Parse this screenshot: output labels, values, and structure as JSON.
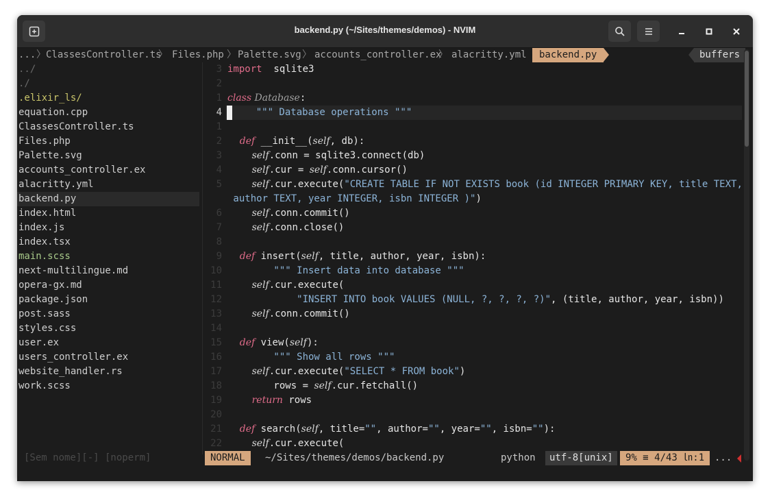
{
  "window": {
    "title": "backend.py (~/Sites/themes/demos) - NVIM"
  },
  "titlebar_icons": {
    "new_tab": "new-tab-icon",
    "search": "search-icon",
    "menu": "hamburger-menu-icon",
    "minimize": "minimize-icon",
    "maximize": "maximize-icon",
    "close": "close-icon"
  },
  "tabline": {
    "ellipsis": "...",
    "tabs": [
      "ClassesController.ts",
      "Files.php",
      "Palette.svg",
      "accounts_controller.ex",
      "alacritty.yml"
    ],
    "active": "backend.py",
    "buffers": "buffers"
  },
  "sidebar": {
    "items": [
      {
        "label": "../",
        "kind": "dir"
      },
      {
        "label": "./",
        "kind": "dir"
      },
      {
        "label": ".elixir_ls/",
        "kind": "lsp"
      },
      {
        "label": "equation.cpp",
        "kind": "file"
      },
      {
        "label": "ClassesController.ts",
        "kind": "file"
      },
      {
        "label": "Files.php",
        "kind": "file"
      },
      {
        "label": "Palette.svg",
        "kind": "file"
      },
      {
        "label": "accounts_controller.ex",
        "kind": "file"
      },
      {
        "label": "alacritty.yml",
        "kind": "file"
      },
      {
        "label": "backend.py",
        "kind": "file",
        "selected": true
      },
      {
        "label": "index.html",
        "kind": "file"
      },
      {
        "label": "index.js",
        "kind": "file"
      },
      {
        "label": "index.tsx",
        "kind": "file"
      },
      {
        "label": "main.scss",
        "kind": "green"
      },
      {
        "label": "next-multilingue.md",
        "kind": "file"
      },
      {
        "label": "opera-gx.md",
        "kind": "file"
      },
      {
        "label": "package.json",
        "kind": "file"
      },
      {
        "label": "post.sass",
        "kind": "file"
      },
      {
        "label": "styles.css",
        "kind": "file"
      },
      {
        "label": "user.ex",
        "kind": "file"
      },
      {
        "label": "users_controller.ex",
        "kind": "file"
      },
      {
        "label": "website_handler.rs",
        "kind": "file"
      },
      {
        "label": "work.scss",
        "kind": "file"
      }
    ]
  },
  "editor": {
    "lines": [
      {
        "n": "3",
        "segs": [
          [
            "kw2",
            "import"
          ],
          [
            "",
            "  sqlite3"
          ]
        ]
      },
      {
        "n": "2",
        "segs": []
      },
      {
        "n": "1",
        "segs": [
          [
            "kw",
            "class"
          ],
          [
            "",
            ""
          ],
          [
            "cls",
            " Database"
          ],
          [
            "",
            ":"
          ]
        ]
      },
      {
        "n": "4",
        "current": true,
        "segs": [
          [
            "",
            ""
          ],
          [
            "str",
            "    \"\"\" Database operations \"\"\""
          ]
        ]
      },
      {
        "n": "1",
        "segs": []
      },
      {
        "n": "2",
        "segs": [
          [
            "kw",
            "    def"
          ],
          [
            "",
            " __init__("
          ],
          [
            "self",
            "self"
          ],
          [
            "",
            ", db):"
          ]
        ]
      },
      {
        "n": "3",
        "segs": [
          [
            "self",
            "        self"
          ],
          [
            "",
            ".conn = sqlite3.connect(db)"
          ]
        ]
      },
      {
        "n": "4",
        "segs": [
          [
            "self",
            "        self"
          ],
          [
            "",
            ".cur = "
          ],
          [
            "self",
            "self"
          ],
          [
            "",
            ".conn.cursor()"
          ]
        ]
      },
      {
        "n": "5",
        "segs": [
          [
            "self",
            "        self"
          ],
          [
            "",
            ".cur.execute("
          ],
          [
            "str",
            "\"CREATE TABLE IF NOT EXISTS book (id INTEGER PRIMARY KEY, title TEXT,"
          ]
        ]
      },
      {
        "n": "",
        "segs": [
          [
            "str",
            " author TEXT, year INTEGER, isbn INTEGER )\""
          ],
          [
            "",
            ")"
          ]
        ]
      },
      {
        "n": "6",
        "segs": [
          [
            "self",
            "        self"
          ],
          [
            "",
            ".conn.commit()"
          ]
        ]
      },
      {
        "n": "7",
        "segs": [
          [
            "self",
            "        self"
          ],
          [
            "",
            ".conn.close()"
          ]
        ]
      },
      {
        "n": "8",
        "segs": []
      },
      {
        "n": "9",
        "segs": [
          [
            "kw",
            "    def"
          ],
          [
            "",
            " insert("
          ],
          [
            "self",
            "self"
          ],
          [
            "",
            ", title, author, year, isbn):"
          ]
        ]
      },
      {
        "n": "10",
        "segs": [
          [
            "str",
            "        \"\"\" Insert data into database \"\"\""
          ]
        ]
      },
      {
        "n": "11",
        "segs": [
          [
            "self",
            "        self"
          ],
          [
            "",
            ".cur.execute("
          ]
        ]
      },
      {
        "n": "12",
        "segs": [
          [
            "str",
            "            \"INSERT INTO book VALUES (NULL, ?, ?, ?, ?)\""
          ],
          [
            "",
            ", (title, author, year, isbn))"
          ]
        ]
      },
      {
        "n": "13",
        "segs": [
          [
            "self",
            "        self"
          ],
          [
            "",
            ".conn.commit()"
          ]
        ]
      },
      {
        "n": "14",
        "segs": []
      },
      {
        "n": "15",
        "segs": [
          [
            "kw",
            "    def"
          ],
          [
            "",
            " view("
          ],
          [
            "self",
            "self"
          ],
          [
            "",
            "):"
          ]
        ]
      },
      {
        "n": "16",
        "segs": [
          [
            "str",
            "        \"\"\" Show all rows \"\"\""
          ]
        ]
      },
      {
        "n": "17",
        "segs": [
          [
            "self",
            "        self"
          ],
          [
            "",
            ".cur.execute("
          ],
          [
            "str",
            "\"SELECT * FROM book\""
          ],
          [
            "",
            ")"
          ]
        ]
      },
      {
        "n": "18",
        "segs": [
          [
            "",
            "        rows = "
          ],
          [
            "self",
            "self"
          ],
          [
            "",
            ".cur.fetchall()"
          ]
        ]
      },
      {
        "n": "19",
        "segs": [
          [
            "kw",
            "        return"
          ],
          [
            "",
            " rows"
          ]
        ]
      },
      {
        "n": "20",
        "segs": []
      },
      {
        "n": "21",
        "segs": [
          [
            "kw",
            "    def"
          ],
          [
            "",
            " search("
          ],
          [
            "self",
            "self"
          ],
          [
            "",
            ", title="
          ],
          [
            "str",
            "\"\""
          ],
          [
            "",
            ", author="
          ],
          [
            "str",
            "\"\""
          ],
          [
            "",
            ", year="
          ],
          [
            "str",
            "\"\""
          ],
          [
            "",
            ", isbn="
          ],
          [
            "str",
            "\"\""
          ],
          [
            "",
            "):"
          ]
        ]
      },
      {
        "n": "22",
        "segs": [
          [
            "self",
            "        self"
          ],
          [
            "",
            ".cur.execute("
          ]
        ]
      }
    ]
  },
  "status": {
    "left": "[Sem nome][-] [noperm]",
    "mode": "NORMAL",
    "file": "~/Sites/themes/demos/backend.py",
    "filetype": "python",
    "encoding": "utf-8[unix]",
    "position": "9% ≡ 4/43 ㏑:1",
    "dots": "..."
  },
  "colors": {
    "accent": "#d6a77e",
    "background": "#1c1c1c",
    "keyword": "#e06c8a",
    "string": "#8cb4d8"
  }
}
